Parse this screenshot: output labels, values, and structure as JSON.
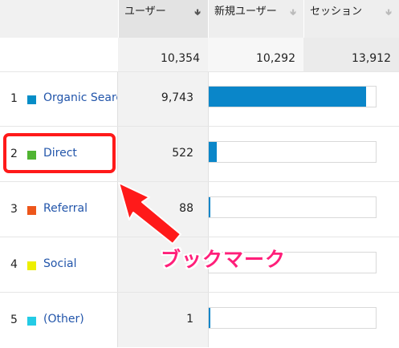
{
  "columns": [
    {
      "label": "ユーザー",
      "sort_icon": "sort-down-arrow-icon",
      "active": true
    },
    {
      "label": "新規ユーザー",
      "sort_icon": "sort-down-arrow-icon",
      "active": false
    },
    {
      "label": "セッション",
      "sort_icon": "sort-down-arrow-icon",
      "active": false
    }
  ],
  "totals": {
    "users": "10,354",
    "new_users": "10,292",
    "sessions": "13,912"
  },
  "rows": [
    {
      "rank": "1",
      "name": "Organic Search",
      "value": "9,743",
      "share": 0.941,
      "color": "#058dc7"
    },
    {
      "rank": "2",
      "name": "Direct",
      "value": "522",
      "share": 0.05,
      "color": "#50b432"
    },
    {
      "rank": "3",
      "name": "Referral",
      "value": "88",
      "share": 0.0085,
      "color": "#ed561b"
    },
    {
      "rank": "4",
      "name": "Social",
      "value": "",
      "share": 0.0,
      "color": "#edef00"
    },
    {
      "rank": "5",
      "name": "(Other)",
      "value": "1",
      "share": 0.0001,
      "color": "#24cbe5"
    }
  ],
  "annotation": {
    "text": "ブックマーク",
    "color": "#ff1f7a",
    "highlight_color": "#ff1a1a"
  }
}
